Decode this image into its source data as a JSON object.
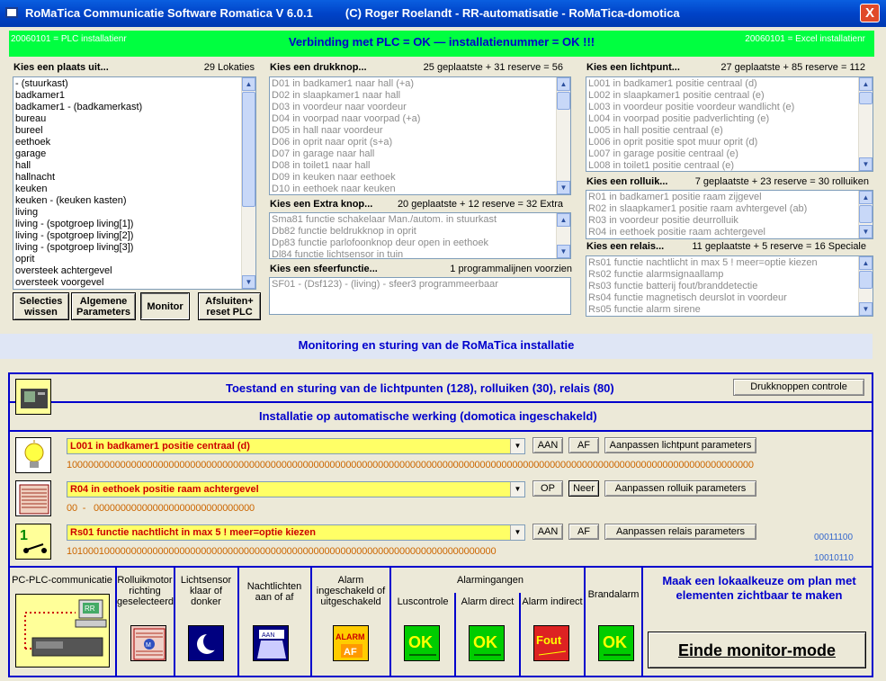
{
  "window": {
    "title": "RoMaTica Communicatie Software Romatica V 6.0.1          (C) Roger Roelandt - RR-automatisatie - RoMaTica-domotica",
    "close": "X"
  },
  "banner": {
    "left": "20060101 = PLC installatienr",
    "center": "Verbinding met PLC = OK  —  installatienummer = OK !!!",
    "right": "20060101 = Excel installatienr"
  },
  "locations": {
    "header": "Kies een plaats uit...",
    "count": "29 Lokaties",
    "items": [
      " - (stuurkast)",
      "badkamer1",
      "badkamer1 - (badkamerkast)",
      "bureau",
      "bureel",
      "eethoek",
      "garage",
      "hall",
      "hallnacht",
      "keuken",
      "keuken - (keuken kasten)",
      "living",
      "living - (spotgroep living[1])",
      "living - (spotgroep living[2])",
      "living - (spotgroep living[3])",
      "oprit",
      "oversteek achtergevel",
      "oversteek voorgevel"
    ]
  },
  "buttons": {
    "clear": "Selecties wissen",
    "params": "Algemene Parameters",
    "monitor": "Monitor",
    "close_reset": "Afsluiten+ reset PLC"
  },
  "pushbuttons": {
    "header": "Kies een drukknop...",
    "count": "25 geplaatste + 31 reserve = 56",
    "items": [
      "D01 in badkamer1 naar hall (+a)",
      "D02 in slaapkamer1 naar hall",
      "D03 in voordeur naar voordeur",
      "D04 in voorpad naar voorpad (+a)",
      "D05 in hall naar voordeur",
      "D06 in oprit naar oprit (s+a)",
      "D07 in garage naar hall",
      "D08 in toilet1 naar hall",
      "D09 in keuken naar eethoek",
      "D10 in eethoek naar keuken"
    ]
  },
  "extrabuttons": {
    "header": "Kies een Extra knop...",
    "count": "20 geplaatste + 12 reserve = 32 Extra",
    "items": [
      "Sma81 functie schakelaar Man./autom. in stuurkast",
      "Db82 functie beldrukknop in oprit",
      "Dp83 functie parlofoonknop deur open in eethoek",
      "Dl84 functie lichtsensor in tuin"
    ]
  },
  "moods": {
    "header": "Kies een sfeerfunctie...",
    "count": "1 programmalijnen voorzien",
    "items": [
      "SF01 - (Dsf123) - (living) - sfeer3 programmeerbaar"
    ]
  },
  "lights": {
    "header": "Kies een lichtpunt...",
    "count": "27 geplaatste + 85 reserve = 112",
    "items": [
      "L001 in badkamer1 positie centraal (d)",
      "L002 in slaapkamer1 positie centraal (e)",
      "L003 in voordeur positie voordeur wandlicht (e)",
      "L004 in voorpad positie padverlichting (e)",
      "L005 in hall positie centraal (e)",
      "L006 in oprit positie spot muur oprit (d)",
      "L007 in garage positie centraal (e)",
      "L008 in toilet1 positie centraal (e)"
    ]
  },
  "shutters": {
    "header": "Kies een rolluik...",
    "count": "7 geplaatste + 23 reserve = 30 rolluiken",
    "items": [
      "R01 in badkamer1 positie raam zijgevel",
      "R02 in slaapkamer1 positie raam avhtergevel (ab)",
      "R03 in voordeur positie deurrolluik",
      "R04 in eethoek positie raam achtergevel"
    ]
  },
  "relays": {
    "header": "Kies een relais...",
    "count": "11 geplaatste + 5 reserve = 16 Speciale",
    "items": [
      "Rs01 functie nachtlicht in max 5 ! meer=optie kiezen",
      "Rs02 functie alarmsignaallamp",
      "Rs03 functie batterij fout/branddetectie",
      "Rs04 functie magnetisch deurslot in voordeur",
      "Rs05 functie alarm sirene"
    ]
  },
  "monitor": {
    "title": "Monitoring en sturing van de RoMaTica installatie",
    "status_title": "Toestand en sturing van de lichtpunten (128), rolluiken (30), relais (80)",
    "controle_btn": "Drukknoppen controle",
    "auto_title": "Installatie op automatische werking (domotica ingeschakeld)"
  },
  "rows": {
    "light": {
      "selected": "L001 in badkamer1 positie centraal (d)",
      "btn1": "AAN",
      "btn2": "AF",
      "adjust": "Aanpassen lichtpunt parameters",
      "bits": "10000000000000000000000000000000000000000000000000000000000000000000000000000000000000000000000000000000000000000000000000000000"
    },
    "shutter": {
      "selected": "R04 in eethoek positie raam achtergevel",
      "btn1": "OP",
      "btn2": "Neer",
      "adjust": "Aanpassen rolluik parameters",
      "bits": "00  -   000000000000000000000000000000"
    },
    "relay": {
      "selected": "Rs01 functie nachtlicht in max 5 ! meer=optie kiezen",
      "btn1": "AAN",
      "btn2": "AF",
      "adjust": "Aanpassen relais parameters",
      "bits": "10100010000000000000000000000000000000000000000000000000000000000000000000000000",
      "side1": "00011100",
      "side2": "10010110"
    }
  },
  "panels": {
    "comm": "PC-PLC-communicatie",
    "motor": "Rolluikmotor richting geselecteerd",
    "sensor": "Lichtsensor klaar of donker",
    "nightlights": "Nachtlichten aan of af",
    "alarm": "Alarm ingeschakeld of uitgeschakeld",
    "alarm_inputs": "Alarmingangen",
    "loop": "Luscontrole",
    "direct": "Alarm direct",
    "indirect": "Alarm indirect",
    "fire": "Brandalarm",
    "hint": "Maak een lokaalkeuze om plan met elementen zichtbaar te maken",
    "end_btn": "Einde monitor-mode",
    "ok1": "OK",
    "ok2": "OK",
    "fout": "Fout",
    "ok3": "OK",
    "alarm_icon": "ALARM",
    "alarm_icon2": "AF",
    "rr": "RR",
    "aan_icon": "AAN"
  },
  "colors": {
    "banner": "#00ff40",
    "accent": "#0000cc",
    "combo": "#ffff66",
    "bits": "#cc6600"
  }
}
